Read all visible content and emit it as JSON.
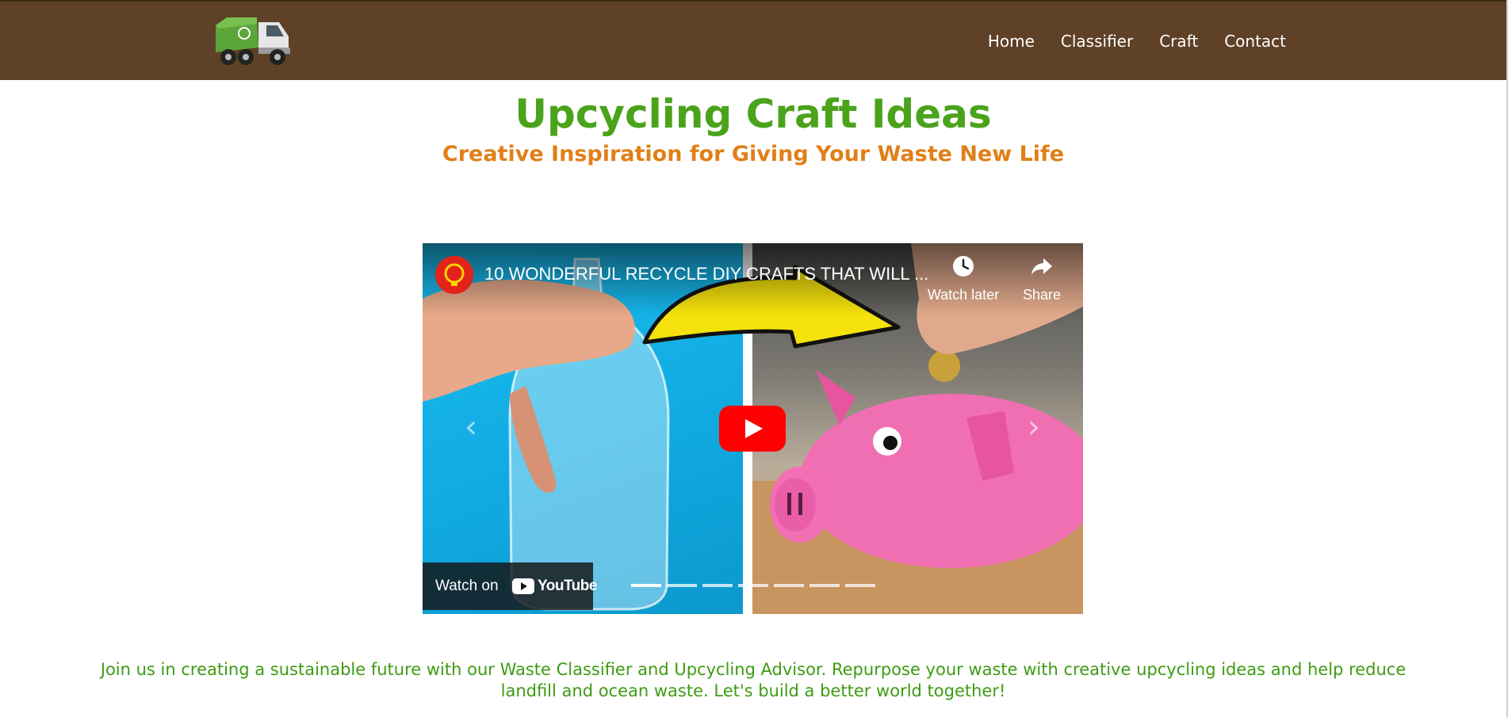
{
  "nav": {
    "logo_icon": "garbage-truck-icon",
    "links": [
      {
        "label": "Home"
      },
      {
        "label": "Classifier"
      },
      {
        "label": "Craft"
      },
      {
        "label": "Contact"
      }
    ]
  },
  "page": {
    "title": "Upcycling Craft Ideas",
    "subtitle": "Creative Inspiration for Giving Your Waste New Life"
  },
  "video": {
    "title": "10 WONDERFUL RECYCLE DIY CRAFTS THAT WILL ...",
    "watch_later_label": "Watch later",
    "share_label": "Share",
    "watch_on_label": "Watch on",
    "youtube_label": "YouTube",
    "prev_glyph": "‹",
    "next_glyph": "›",
    "slides_count": 7,
    "active_slide": 0
  },
  "footer": {
    "text": "Join us in creating a sustainable future with our Waste Classifier and Upcycling Advisor. Repurpose your waste with creative upcycling ideas and help reduce landfill and ocean waste. Let's build a better world together!"
  },
  "colors": {
    "navbar": "#5e4126",
    "title": "#4aa31b",
    "subtitle": "#e08018",
    "footer_text": "#3d9c12",
    "youtube_red": "#ff0000"
  }
}
